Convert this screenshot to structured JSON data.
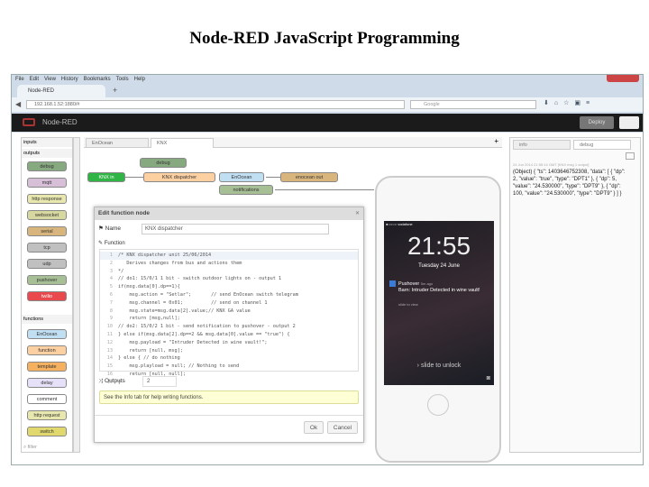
{
  "slide_title": "Node-RED JavaScript Programming",
  "browser": {
    "menu": [
      "File",
      "Edit",
      "View",
      "History",
      "Bookmarks",
      "Tools",
      "Help"
    ],
    "tab_title": "Node-RED",
    "new_tab": "+",
    "url": "192.168.1.52:1880/#",
    "search_placeholder": "Google"
  },
  "app": {
    "name": "Node-RED",
    "deploy_label": "Deploy"
  },
  "palette": {
    "inputs_label": "inputs",
    "outputs_label": "outputs",
    "outputs": [
      {
        "label": "debug",
        "color": "#87a980"
      },
      {
        "label": "mqtt",
        "color": "#d8bfd8"
      },
      {
        "label": "http response",
        "color": "#e7e7ae"
      },
      {
        "label": "websocket",
        "color": "#d7d7a0"
      },
      {
        "label": "serial",
        "color": "#d8b57d"
      },
      {
        "label": "tcp",
        "color": "#c0c0c0"
      },
      {
        "label": "udp",
        "color": "#c0c0c0"
      },
      {
        "label": "pushover",
        "color": "#a6bf94"
      },
      {
        "label": "twilio",
        "color": "#e9484c"
      }
    ],
    "functions_label": "functions",
    "functions": [
      {
        "label": "EnOcean",
        "color": "#c0dff2"
      },
      {
        "label": "function",
        "color": "#fdd0a2"
      },
      {
        "label": "template",
        "color": "#f5b15f"
      },
      {
        "label": "delay",
        "color": "#e6e0f8"
      },
      {
        "label": "comment",
        "color": "#ffffff"
      },
      {
        "label": "http request",
        "color": "#e7e7ae"
      },
      {
        "label": "switch",
        "color": "#e2d96e"
      }
    ],
    "filter_placeholder": "filter"
  },
  "workspace": {
    "tabs": [
      "EnOcean",
      "KNX"
    ],
    "add_tab": "+",
    "nodes": {
      "knx_in": "KNX in",
      "debug": "debug",
      "dispatcher": "KNX dispatcher",
      "enocean": "EnOcean",
      "enocean_out": "enocean out",
      "notifications": "notifications"
    }
  },
  "dialog": {
    "title": "Edit function node",
    "name_label": "Name",
    "name_value": "KNX dispatcher",
    "function_label": "Function",
    "code": [
      "/* KNX dispatcher unit 25/06/2014",
      "   Derives changes from bus and actions them",
      "*/",
      "// do1: 15/0/1 1 bit - switch outdoor lights on - output 1",
      "if(msg.data[0].dp==1){",
      "    msg.action = \"Setlar\";       // send EnOcean switch telegram",
      "    msg.channel = 0x01;          // send on channel 1",
      "    msg.state=msg.data[2].value;// KNX GA value",
      "    return [msg,null];",
      "// do2: 15/0/2 1 bit - send notification to pushover - output 2",
      "} else if(msg.data[2].dp==2 && msg.data[0].value == \"true\") {",
      "    msg.payload = \"Intruder Detected in wine vault!\";",
      "    return [null, msg];",
      "} else { // do nothing",
      "    msg.playload = null; // Nothing to send",
      "    return [null, null];",
      "}"
    ],
    "outputs_label": "Outputs",
    "outputs_value": "2",
    "tip": "See the Info tab for help writing functions.",
    "ok": "Ok",
    "cancel": "Cancel"
  },
  "sidebar": {
    "tabs": [
      "info",
      "debug"
    ],
    "debug_meta": "24 Jun 2014 21:55:14 GMT  [KNX msg 1 output]",
    "debug_msg": "(Object) { \"ts\": 1403646752308, \"data\": [ { \"dp\": 2, \"value\": \"true\", \"type\": \"DPT1\" }, { \"dp\": 5, \"value\": \"24.530000\", \"type\": \"DPT9\" }, { \"dp\": 100, \"value\": \"24.530000\", \"type\": \"DPT9\" } ] }"
  },
  "phone": {
    "carrier": "●○○○○ vodafone",
    "time": "21:55",
    "date": "Tuesday 24 June",
    "notif_app": "Pushover",
    "notif_age": "5m ago",
    "notif_text": "Barn: Intruder Detected in wine vault!",
    "notif_action": "slide to view",
    "unlock": "slide to unlock"
  }
}
